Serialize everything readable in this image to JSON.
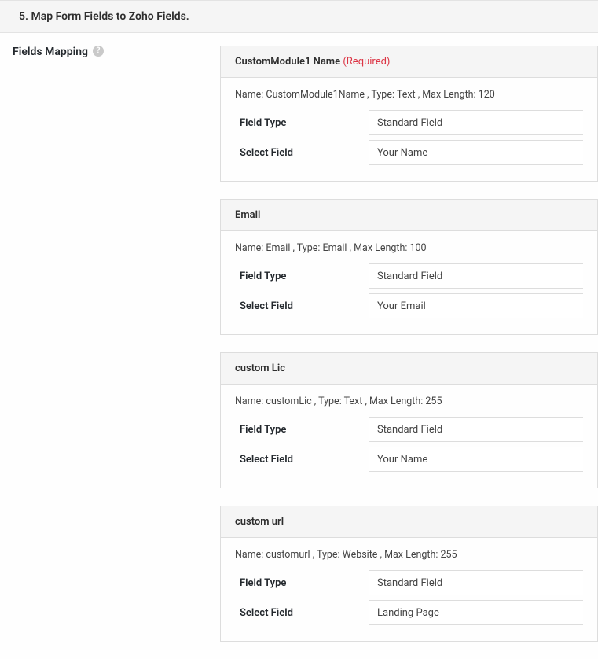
{
  "sectionTitle": "5. Map Form Fields to Zoho Fields.",
  "fieldsMappingLabel": "Fields Mapping",
  "helpIconLabel": "?",
  "labels": {
    "fieldType": "Field Type",
    "selectField": "Select Field"
  },
  "requiredText": "(Required)",
  "cards": [
    {
      "title": "CustomModule1 Name",
      "required": true,
      "meta": "Name: CustomModule1Name , Type: Text , Max Length: 120",
      "fieldTypeValue": "Standard Field",
      "selectFieldValue": "Your Name"
    },
    {
      "title": "Email",
      "required": false,
      "meta": "Name: Email , Type: Email , Max Length: 100",
      "fieldTypeValue": "Standard Field",
      "selectFieldValue": "Your Email"
    },
    {
      "title": "custom Lic",
      "required": false,
      "meta": "Name: customLic , Type: Text , Max Length: 255",
      "fieldTypeValue": "Standard Field",
      "selectFieldValue": "Your Name"
    },
    {
      "title": "custom url",
      "required": false,
      "meta": "Name: customurl , Type: Website , Max Length: 255",
      "fieldTypeValue": "Standard Field",
      "selectFieldValue": "Landing Page"
    }
  ]
}
